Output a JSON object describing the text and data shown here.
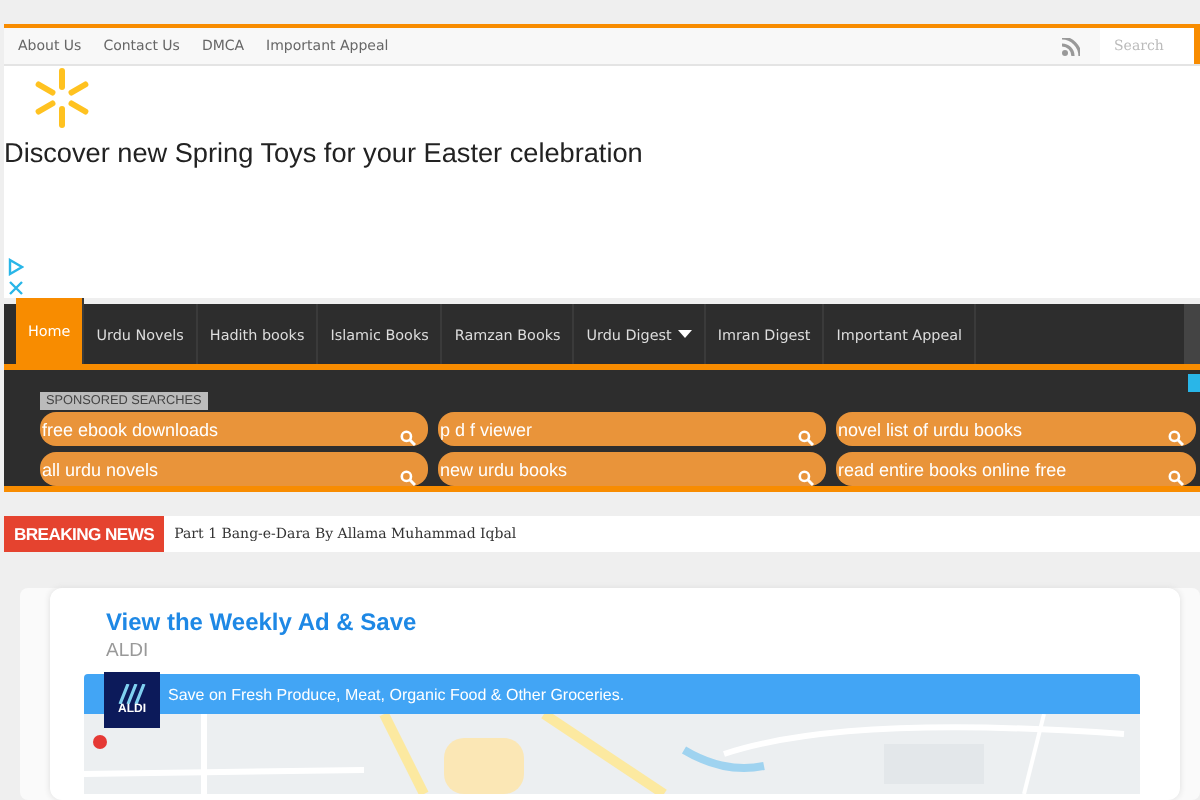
{
  "top_menu": [
    {
      "label": "About Us"
    },
    {
      "label": "Contact Us"
    },
    {
      "label": "DMCA"
    },
    {
      "label": "Important Appeal"
    }
  ],
  "search": {
    "placeholder": "Search"
  },
  "ad_banner": {
    "headline": "Discover new Spring Toys for your Easter celebration"
  },
  "main_nav": [
    {
      "label": "Home",
      "selected": true,
      "dropdown": false
    },
    {
      "label": "Urdu Novels",
      "selected": false,
      "dropdown": false
    },
    {
      "label": "Hadith books",
      "selected": false,
      "dropdown": false
    },
    {
      "label": "Islamic Books",
      "selected": false,
      "dropdown": false
    },
    {
      "label": "Ramzan Books",
      "selected": false,
      "dropdown": false
    },
    {
      "label": "Urdu Digest",
      "selected": false,
      "dropdown": true
    },
    {
      "label": "Imran Digest",
      "selected": false,
      "dropdown": false
    },
    {
      "label": "Important Appeal",
      "selected": false,
      "dropdown": false
    }
  ],
  "sponsored": {
    "title": "SPONSORED SEARCHES",
    "links": [
      {
        "label": "free ebook downloads"
      },
      {
        "label": "p d f viewer"
      },
      {
        "label": "novel list of urdu books"
      },
      {
        "label": "all urdu novels"
      },
      {
        "label": "new urdu books"
      },
      {
        "label": "read entire books online free"
      }
    ]
  },
  "breaking_news": {
    "label": "BREAKING NEWS",
    "headline": "Part 1 Bang-e-Dara By Allama Muhammad Iqbal"
  },
  "store_ad": {
    "title": "View the Weekly Ad & Save",
    "advertiser": "ALDI",
    "logo_text": "ALDI",
    "tagline": "Save on Fresh Produce, Meat, Organic Food & Other Groceries."
  }
}
